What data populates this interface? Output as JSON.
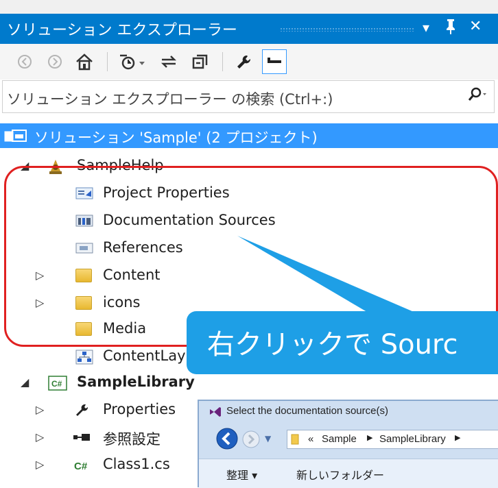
{
  "header": {
    "title": "ソリューション エクスプローラー",
    "dropdown_icon": "▾",
    "pin_icon": "ꟸ",
    "close_icon": "✕"
  },
  "toolbar": {
    "buttons": [
      "back",
      "forward",
      "home",
      "pending-changes-filter",
      "sync-with-active-document",
      "collapse-all",
      "properties",
      "preview-selected-items"
    ]
  },
  "search": {
    "placeholder": "ソリューション エクスプローラー の検索 (Ctrl+:)"
  },
  "tree": {
    "solution": "ソリューション 'Sample' (2 プロジェクト)",
    "project1": {
      "name": "SampleHelp",
      "items": [
        "Project Properties",
        "Documentation Sources",
        "References",
        "Content",
        "icons",
        "Media",
        "ContentLay"
      ]
    },
    "project2": {
      "name": "SampleLibrary",
      "items": [
        "Properties",
        "参照設定",
        "Class1.cs"
      ]
    }
  },
  "callout": {
    "text": "右クリックで Sourc"
  },
  "dialog": {
    "title": "Select the documentation source(s)",
    "breadcrumb": [
      "«",
      "Sample",
      "SampleLibrary"
    ],
    "organize": "整理 ▾",
    "new_folder": "新しいフォルダー"
  },
  "colors": {
    "accent": "#007acc",
    "selection": "#3399ff",
    "callout": "#1e9fe6",
    "highlight": "#e02020"
  }
}
